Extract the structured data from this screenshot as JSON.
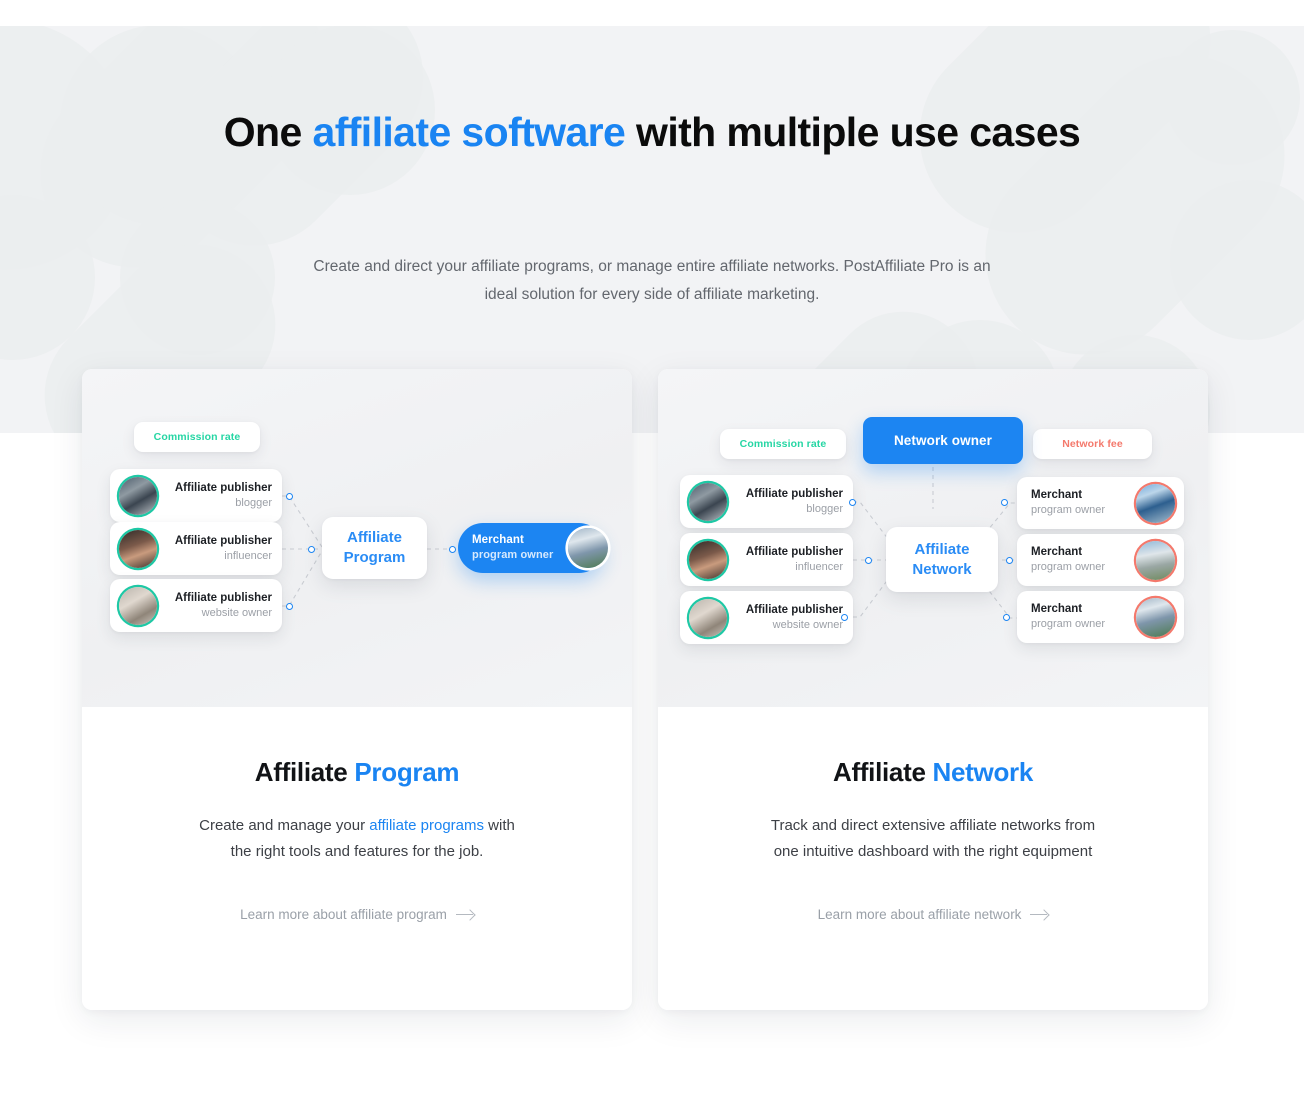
{
  "heading": {
    "part1": "One ",
    "accent": "affiliate software",
    "part2": " with multiple use cases"
  },
  "subhead": "Create and direct your affiliate programs, or manage entire affiliate networks. PostAffiliate Pro is an ideal solution for every side of affiliate marketing.",
  "colors": {
    "accent_blue": "#1a84f2",
    "teal": "#26d6a4",
    "salmon": "#f4796c",
    "heading_black": "#0b0b0b",
    "body_grey": "#63676e",
    "hero_bg": "#f2f3f5"
  },
  "cards": [
    {
      "title_plain": "Affiliate ",
      "title_accent": "Program",
      "desc_part1": "Create and manage your ",
      "desc_link": "affiliate programs",
      "desc_part2": " with the right tools and features for the job.",
      "link_label": "Learn more about affiliate program",
      "diagram": {
        "badge": "Commission rate",
        "hub_line1": "Affiliate",
        "hub_line2": "Program",
        "publishers": [
          {
            "title": "Affiliate publisher",
            "subtitle": "blogger"
          },
          {
            "title": "Affiliate publisher",
            "subtitle": "influencer"
          },
          {
            "title": "Affiliate publisher",
            "subtitle": "website owner"
          }
        ],
        "merchants": [
          {
            "title": "Merchant",
            "subtitle": "program owner"
          }
        ]
      }
    },
    {
      "title_plain": "Affiliate ",
      "title_accent": "Network",
      "desc_part1": "Track and direct extensive affiliate networks from one intuitive dashboard with the right equipment",
      "desc_link": "",
      "desc_part2": "",
      "link_label": "Learn more about affiliate network",
      "diagram": {
        "badge": "Commission rate",
        "badge_right": "Network fee",
        "owner": "Network owner",
        "hub_line1": "Affiliate",
        "hub_line2": "Network",
        "publishers": [
          {
            "title": "Affiliate publisher",
            "subtitle": "blogger"
          },
          {
            "title": "Affiliate publisher",
            "subtitle": "influencer"
          },
          {
            "title": "Affiliate publisher",
            "subtitle": "website owner"
          }
        ],
        "merchants": [
          {
            "title": "Merchant",
            "subtitle": "program owner"
          },
          {
            "title": "Merchant",
            "subtitle": "program owner"
          },
          {
            "title": "Merchant",
            "subtitle": "program owner"
          }
        ]
      }
    }
  ]
}
